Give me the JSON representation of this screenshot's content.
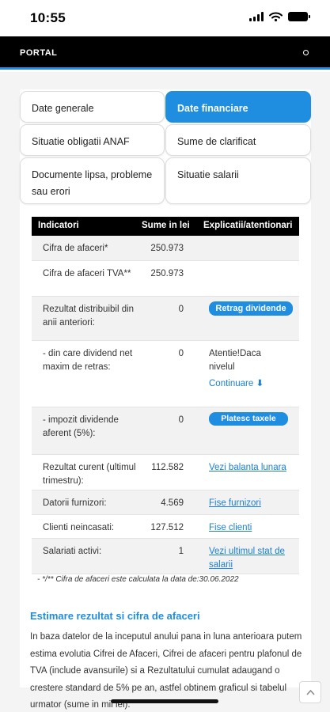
{
  "status_bar": {
    "time": "10:55"
  },
  "app_bar": {
    "title": "PORTAL"
  },
  "tabs": [
    {
      "label": "Date generale"
    },
    {
      "label": "Date financiare",
      "active": true
    },
    {
      "label": "Situatie obligatii ANAF"
    },
    {
      "label": "Sume de clarificat"
    },
    {
      "label": "Documente lipsa, probleme sau erori"
    },
    {
      "label": "Situatie salarii"
    }
  ],
  "table": {
    "headers": [
      "Indicatori",
      "Sume in lei",
      "Explicatii/atentionari"
    ],
    "rows": [
      {
        "label": "Cifra de afaceri*",
        "value": "250.973",
        "explanation": ""
      },
      {
        "label": "Cifra de afaceri TVA**",
        "value": "250.973",
        "explanation": ""
      },
      {
        "label": "Rezultat distribuibil din anii anteriori:",
        "value": "0",
        "explanation": "Retrag dividende"
      },
      {
        "label": "- din care dividend net maxim de retras:",
        "value": "0",
        "explanation": "Atentie!Daca nivelul",
        "explanation_link": "Continuare"
      },
      {
        "label": "- impozit dividende aferent (5%):",
        "value": "0",
        "explanation": "Platesc taxele"
      },
      {
        "label": "Rezultat curent (ultimul trimestru):",
        "value": "112.582",
        "explanation": "Vezi balanta lunara"
      },
      {
        "label": "Datorii furnizori:",
        "value": "4.569",
        "explanation": "Fise furnizori"
      },
      {
        "label": "Clienti neincasati:",
        "value": "127.512",
        "explanation": "Fise clienti"
      },
      {
        "label": "Salariati activi:",
        "value": "1",
        "explanation": "Vezi ultimul stat de salarii"
      }
    ],
    "note": "- */** Cifra de afaceri este calculata la data de:30.06.2022"
  },
  "estimate": {
    "title": "Estimare rezultat si cifra de afaceri",
    "text": "In baza datelor de la inceputul anului pana in luna anterioara putem estima evolutia Cifrei de Afaceri, Cifrei de afaceri pentru plafonul de TVA (include avansurile) si a Rezultatului cumulat adaugand o crestere standard de 5% pe an, astfel obtinem graficul si tabelul urmator (sume in mii lei)."
  },
  "colors": {
    "accent": "#1f8de0",
    "appbar": "#000000",
    "link": "#1a7fd6"
  }
}
